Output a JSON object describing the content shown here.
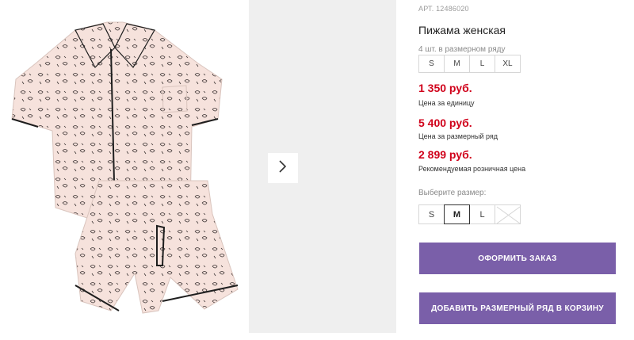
{
  "product": {
    "article": "АРТ. 12486020",
    "title": "Пижама женская",
    "pack_note": "4 шт. в размерном ряду",
    "pack_sizes": [
      "S",
      "M",
      "L",
      "XL"
    ],
    "prices": [
      {
        "value": "1 350 руб.",
        "label": "Цена за единицу"
      },
      {
        "value": "5 400 руб.",
        "label": "Цена за размерный ряд"
      },
      {
        "value": "2 899 руб.",
        "label": "Рекомендуемая розничная цена"
      }
    ],
    "choose_label": "Выберите размер:",
    "choose_sizes": [
      {
        "label": "S",
        "state": "available"
      },
      {
        "label": "M",
        "state": "selected"
      },
      {
        "label": "L",
        "state": "available"
      },
      {
        "label": "",
        "state": "disabled"
      }
    ]
  },
  "buttons": {
    "order": "ОФОРМИТЬ ЗАКАЗ",
    "add_pack": "ДОБАВИТЬ РАЗМЕРНЫЙ РЯД В КОРЗИНУ"
  },
  "colors": {
    "price": "#d0021b",
    "button": "#7a5fa9",
    "fabric": "#f6e2dc",
    "piping": "#1e1e1e"
  },
  "icons": {
    "next": "chevron-right-icon"
  }
}
